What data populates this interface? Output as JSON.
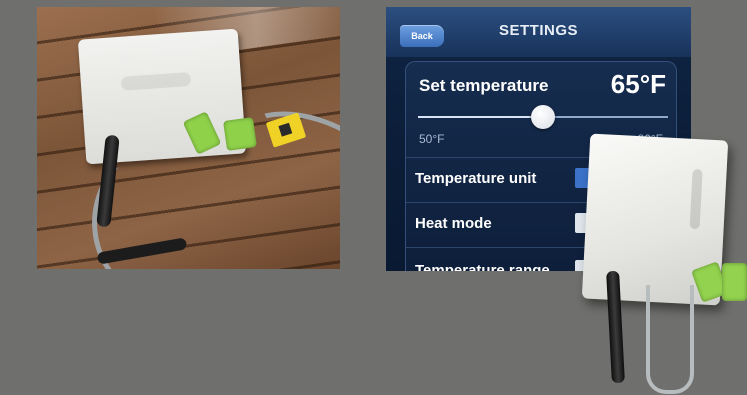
{
  "screen": {
    "back_label": "Back",
    "title": "SETTINGS"
  },
  "settings": {
    "set_temperature_label": "Set temperature",
    "set_temperature_value": "65°F",
    "slider": {
      "min_label": "50°F",
      "max_label": "80°F",
      "min": 50,
      "max": 80,
      "value": 65
    },
    "rows": [
      {
        "label": "Temperature unit",
        "toggle": "on"
      },
      {
        "label": "Heat mode",
        "toggle": "off"
      },
      {
        "label": "Temperature range",
        "toggle": "off"
      }
    ]
  },
  "colors": {
    "accent_blue": "#3c72c8",
    "background": "#6f6f6d",
    "panel": "#0f2645"
  },
  "icons": {
    "back": "back-arrow-icon"
  }
}
